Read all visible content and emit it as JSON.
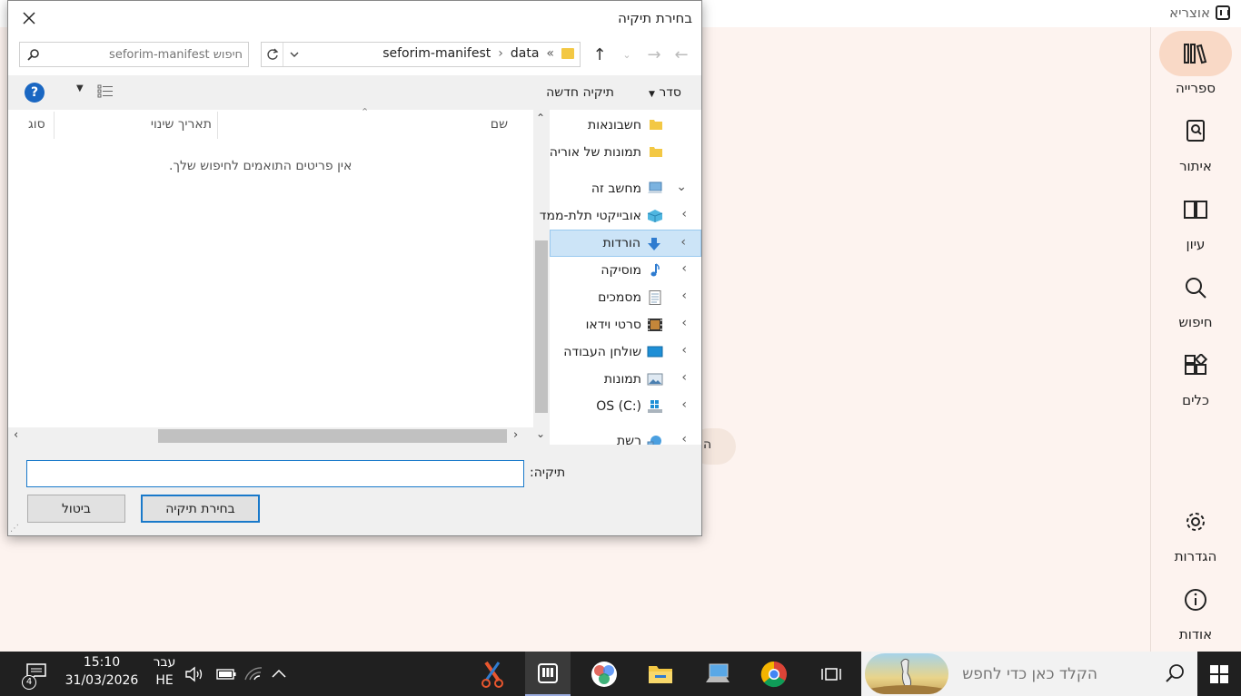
{
  "app": {
    "title": "אוצריא",
    "sidebar": [
      {
        "label": "ספרייה",
        "icon": "library-icon",
        "active": true
      },
      {
        "label": "איתור",
        "icon": "find-book-icon"
      },
      {
        "label": "עיון",
        "icon": "open-book-icon"
      },
      {
        "label": "חיפוש",
        "icon": "search-icon"
      },
      {
        "label": "כלים",
        "icon": "tools-icon"
      },
      {
        "label": "הגדרות",
        "icon": "gear-icon"
      },
      {
        "label": "אודות",
        "icon": "info-icon"
      }
    ],
    "chip_text": "ה"
  },
  "dialog": {
    "title": "בחירת תיקיה",
    "search_placeholder": "חיפוש seforim-manifest",
    "breadcrumb": [
      "data",
      "seforim-manifest"
    ],
    "breadcrumb_prefix": "«",
    "toolbar": {
      "sort": "סדר",
      "new_folder": "תיקיה חדשה",
      "help": "?"
    },
    "columns": {
      "name": "שם",
      "modified": "תאריך שינוי",
      "type": "סוג"
    },
    "empty_message": "אין פריטים התואמים לחיפוש שלך.",
    "tree": [
      {
        "label": "חשבונאות",
        "icon": "folder-icon",
        "chevron": ""
      },
      {
        "label": "תמונות של אוריה",
        "icon": "folder-icon",
        "chevron": ""
      },
      {
        "label": "מחשב זה",
        "icon": "computer-icon",
        "chevron": "⌄"
      },
      {
        "label": "אובייקטי תלת-ממד",
        "icon": "3d-objects-icon",
        "chevron": "›"
      },
      {
        "label": "הורדות",
        "icon": "download-icon",
        "chevron": "›",
        "selected": true
      },
      {
        "label": "מוסיקה",
        "icon": "music-icon",
        "chevron": "›"
      },
      {
        "label": "מסמכים",
        "icon": "documents-icon",
        "chevron": "›"
      },
      {
        "label": "סרטי וידאו",
        "icon": "video-icon",
        "chevron": "›"
      },
      {
        "label": "שולחן העבודה",
        "icon": "desktop-icon",
        "chevron": "›"
      },
      {
        "label": "תמונות",
        "icon": "pictures-icon",
        "chevron": "›"
      },
      {
        "label": "OS (C:)",
        "icon": "drive-icon",
        "chevron": "›"
      },
      {
        "label": "רשת",
        "icon": "network-icon",
        "chevron": "›"
      }
    ],
    "folder_label": "תיקיה:",
    "folder_value": "",
    "select_button": "בחירת תיקיה",
    "cancel_button": "ביטול"
  },
  "taskbar": {
    "search_placeholder": "הקלד כאן כדי לחפש",
    "time": "15:10",
    "date": "31/03/2026",
    "language_top": "עבר",
    "language_bottom": "HE",
    "notification_count": "4"
  }
}
